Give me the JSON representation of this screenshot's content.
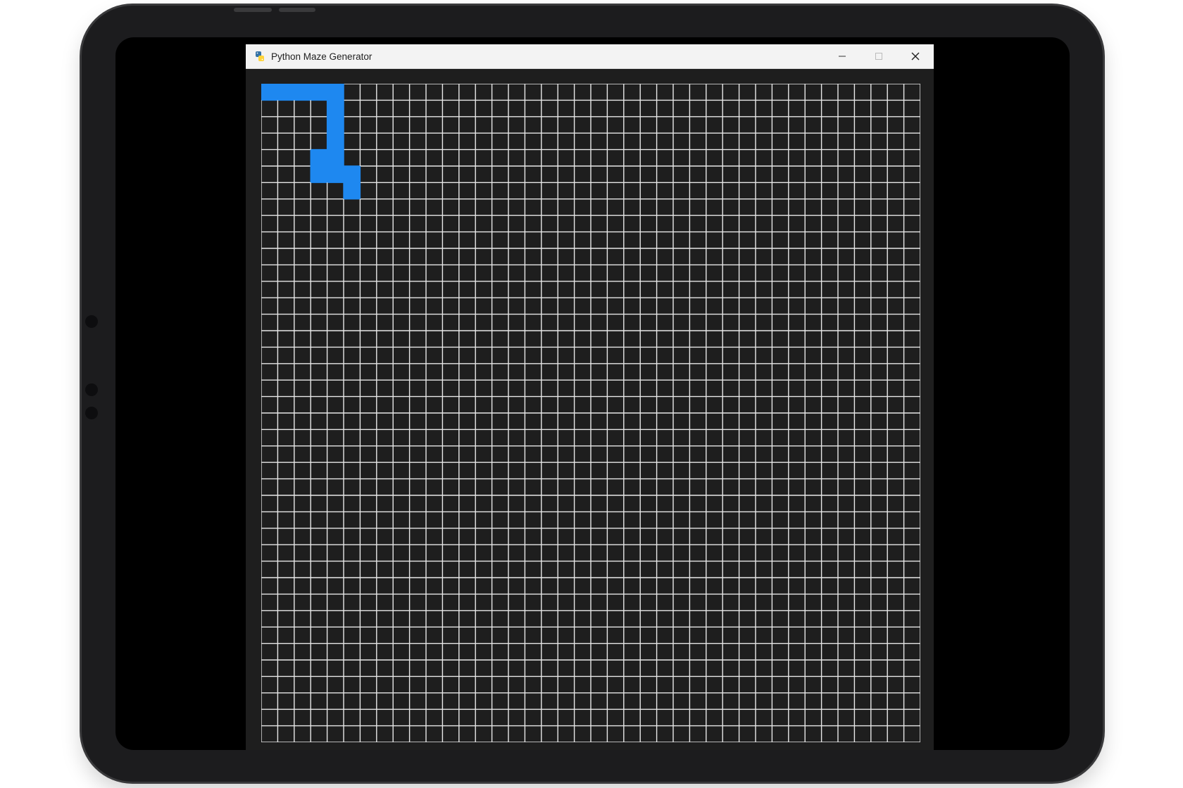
{
  "window": {
    "title": "Python Maze Generator",
    "app_icon": "python-icon",
    "controls": [
      "minimize-icon",
      "maximize-icon",
      "close-icon"
    ]
  },
  "maze": {
    "columns": 40,
    "rows": 40,
    "background_color": "#1e1e1e",
    "grid_color": "#e8e8e8",
    "path_color": "#1e88f0",
    "visited_cells": [
      [
        0,
        0
      ],
      [
        1,
        0
      ],
      [
        2,
        0
      ],
      [
        3,
        0
      ],
      [
        4,
        0
      ],
      [
        4,
        1
      ],
      [
        4,
        2
      ],
      [
        4,
        3
      ],
      [
        3,
        4
      ],
      [
        4,
        4
      ],
      [
        3,
        5
      ],
      [
        4,
        5
      ],
      [
        5,
        5
      ],
      [
        5,
        6
      ]
    ]
  },
  "colors": {
    "device_frame": "#1c1c1e",
    "screen": "#000000",
    "titlebar": "#f3f3f3"
  }
}
